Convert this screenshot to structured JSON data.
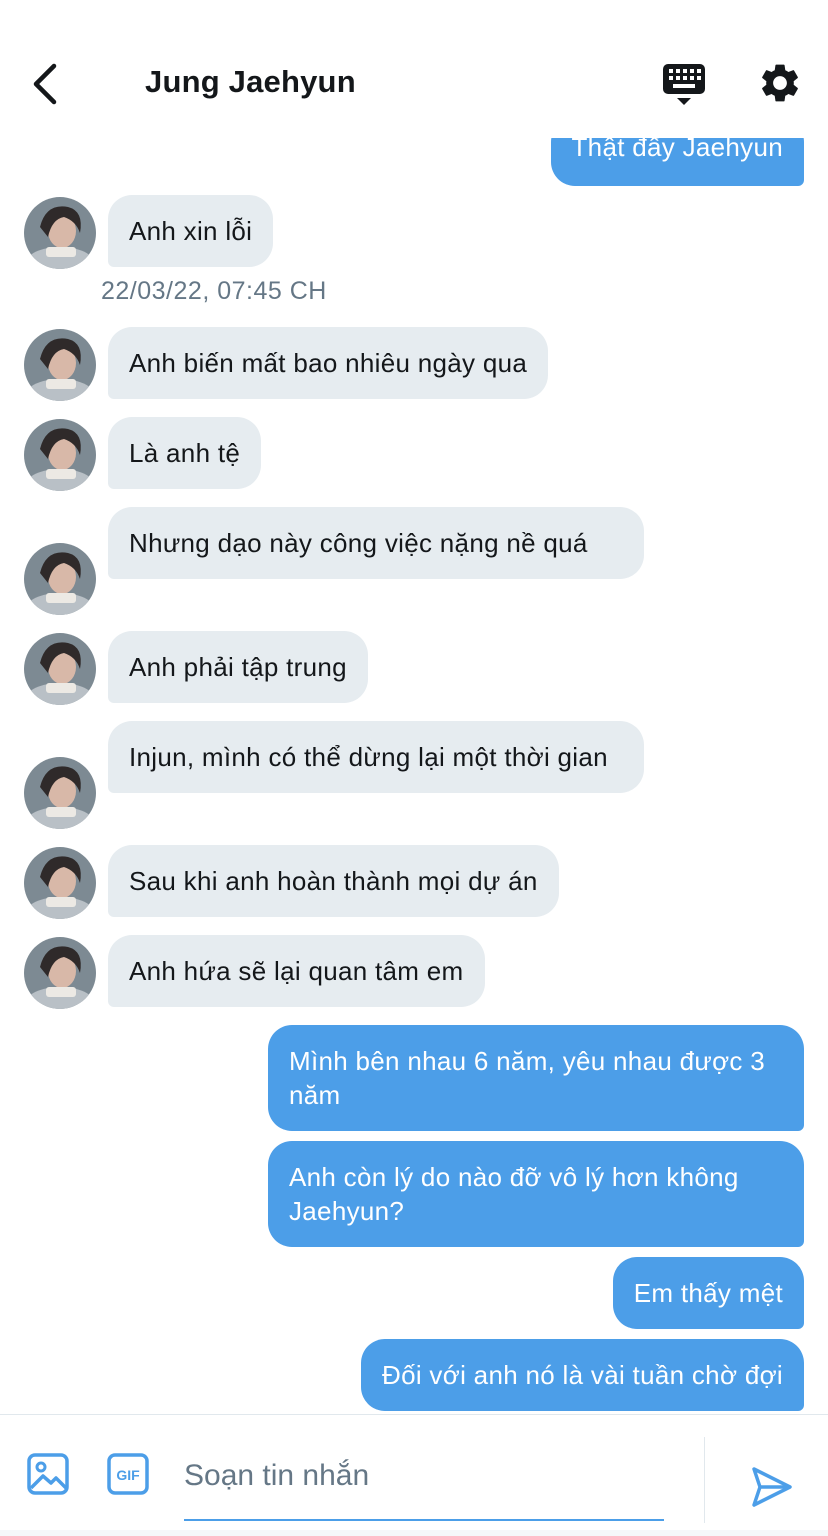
{
  "header": {
    "title": "Jung Jaehyun",
    "back_icon": "chevron-left-icon",
    "keyboard_icon": "keyboard-icon",
    "settings_icon": "gear-icon"
  },
  "colors": {
    "accent": "#4c9ee8",
    "received_bubble": "#e6ecf0",
    "timestamp_text": "#657786"
  },
  "messages": [
    {
      "type": "sent",
      "text": "Thật đấy Jaehyun"
    },
    {
      "type": "received",
      "text": "Anh xin lỗi"
    },
    {
      "type": "timestamp",
      "text": "22/03/22, 07:45 CH"
    },
    {
      "type": "received",
      "text": "Anh biến mất bao nhiêu ngày qua"
    },
    {
      "type": "received",
      "text": "Là anh tệ"
    },
    {
      "type": "received",
      "text": "Nhưng dạo này công việc nặng nề quá"
    },
    {
      "type": "received",
      "text": "Anh phải tập trung"
    },
    {
      "type": "received",
      "text": "Injun, mình có thể dừng lại một thời gian"
    },
    {
      "type": "received",
      "text": "Sau khi anh hoàn thành mọi dự án"
    },
    {
      "type": "received",
      "text": "Anh hứa sẽ lại quan tâm em"
    },
    {
      "type": "sent",
      "text": "Mình bên nhau 6 năm, yêu nhau được 3 năm"
    },
    {
      "type": "sent",
      "text": "Anh còn lý do nào đỡ vô lý hơn không Jaehyun?"
    },
    {
      "type": "sent",
      "text": "Em thấy mệt"
    },
    {
      "type": "sent",
      "text": "Đối với anh nó là vài tuần chờ đợi"
    }
  ],
  "composer": {
    "placeholder": "Soạn tin nhắn",
    "image_icon": "image-icon",
    "gif_icon": "gif-icon",
    "gif_label": "GIF",
    "send_icon": "send-icon"
  }
}
